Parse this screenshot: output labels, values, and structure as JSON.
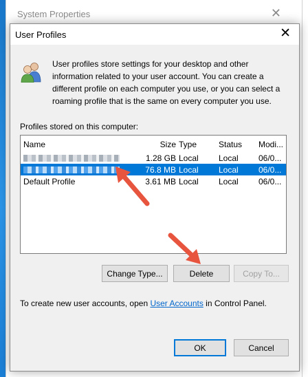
{
  "back_window": {
    "title": "System Properties",
    "close_glyph": "✕"
  },
  "dialog": {
    "title": "User Profiles",
    "close_glyph": "✕",
    "description": "User profiles store settings for your desktop and other information related to your user account. You can create a different profile on each computer you use, or you can select a roaming profile that is the same on every computer you use.",
    "list_label": "Profiles stored on this computer:",
    "columns": [
      "Name",
      "Size",
      "Type",
      "Status",
      "Modi..."
    ],
    "rows": [
      {
        "name": "",
        "size": "1.28 GB",
        "type": "Local",
        "status": "Local",
        "modified": "06/0...",
        "selected": false
      },
      {
        "name": "",
        "size": "76.8 MB",
        "type": "Local",
        "status": "Local",
        "modified": "06/0...",
        "selected": true
      },
      {
        "name": "Default Profile",
        "size": "3.61 MB",
        "type": "Local",
        "status": "Local",
        "modified": "06/0...",
        "selected": false
      }
    ],
    "buttons": {
      "change_type": "Change Type...",
      "delete": "Delete",
      "copy_to": "Copy To...",
      "ok": "OK",
      "cancel": "Cancel"
    },
    "footer": {
      "prefix": "To create new user accounts, open ",
      "link": "User Accounts",
      "suffix": " in Control Panel."
    }
  },
  "icons": {
    "users": "users-icon",
    "arrow": "red-arrow-icon"
  },
  "colors": {
    "selection": "#0078d7",
    "link": "#0066cc",
    "arrow": "#e8553f"
  }
}
